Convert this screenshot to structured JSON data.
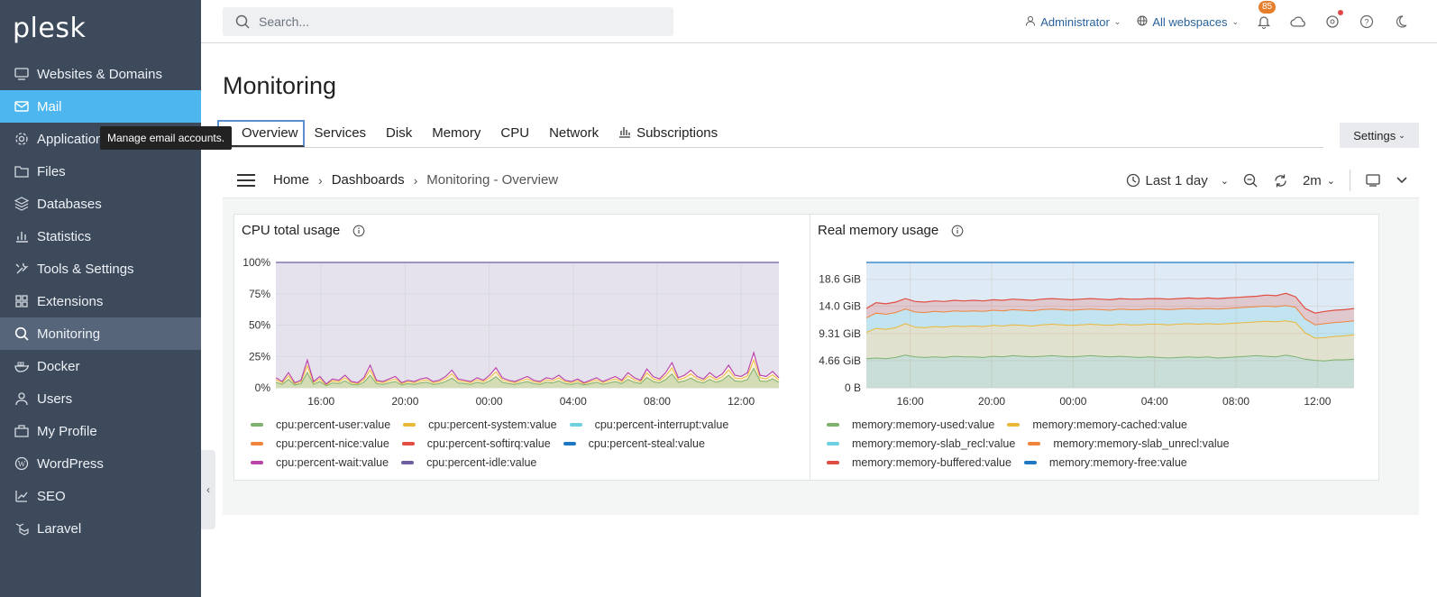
{
  "brand": "plesk",
  "sidebar": {
    "items": [
      {
        "label": "Websites & Domains",
        "icon": "monitor-icon"
      },
      {
        "label": "Mail",
        "icon": "mail-icon"
      },
      {
        "label": "Applications",
        "icon": "gear-icon"
      },
      {
        "label": "Files",
        "icon": "folder-icon"
      },
      {
        "label": "Databases",
        "icon": "database-icon"
      },
      {
        "label": "Statistics",
        "icon": "bar-chart-icon"
      },
      {
        "label": "Tools & Settings",
        "icon": "tools-icon"
      },
      {
        "label": "Extensions",
        "icon": "extensions-icon"
      },
      {
        "label": "Monitoring",
        "icon": "monitoring-icon"
      },
      {
        "label": "Docker",
        "icon": "docker-icon"
      },
      {
        "label": "Users",
        "icon": "user-icon"
      },
      {
        "label": "My Profile",
        "icon": "profile-icon"
      },
      {
        "label": "WordPress",
        "icon": "wordpress-icon"
      },
      {
        "label": "SEO",
        "icon": "seo-icon"
      },
      {
        "label": "Laravel",
        "icon": "laravel-icon"
      }
    ],
    "tooltip": "Manage email accounts.",
    "collapse_glyph": "‹"
  },
  "topbar": {
    "search_placeholder": "Search...",
    "user": "Administrator",
    "webspaces": "All webspaces",
    "notifications_count": "85"
  },
  "page": {
    "title": "Monitoring",
    "tabs": [
      "Overview",
      "Services",
      "Disk",
      "Memory",
      "CPU",
      "Network",
      "Subscriptions"
    ],
    "settings_label": "Settings"
  },
  "dashboard": {
    "breadcrumb": [
      "Home",
      "Dashboards",
      "Monitoring - Overview"
    ],
    "time_range": "Last 1 day",
    "refresh": "2m"
  },
  "colors": {
    "sidebar": "#3d4a5c",
    "active": "#4db6ef",
    "green": "#7eb26d",
    "yellow": "#eab839",
    "lightblue": "#6ed0e0",
    "orange": "#ef843c",
    "red": "#e24d42",
    "blue": "#1f78c1",
    "magenta": "#ba43a9",
    "purple": "#705da0"
  },
  "chart_data": [
    {
      "type": "area",
      "title": "CPU total usage",
      "x_ticks": [
        "16:00",
        "20:00",
        "00:00",
        "04:00",
        "08:00",
        "12:00"
      ],
      "y_ticks": [
        "0%",
        "25%",
        "50%",
        "75%",
        "100%"
      ],
      "ylim": [
        0,
        100
      ],
      "series": [
        {
          "name": "cpu:percent-user:value",
          "color": "#7eb26d"
        },
        {
          "name": "cpu:percent-system:value",
          "color": "#eab839"
        },
        {
          "name": "cpu:percent-interrupt:value",
          "color": "#6ed0e0"
        },
        {
          "name": "cpu:percent-nice:value",
          "color": "#ef843c"
        },
        {
          "name": "cpu:percent-softirq:value",
          "color": "#e24d42"
        },
        {
          "name": "cpu:percent-steal:value",
          "color": "#1f78c1"
        },
        {
          "name": "cpu:percent-wait:value",
          "color": "#ba43a9"
        },
        {
          "name": "cpu:percent-idle:value",
          "color": "#705da0"
        }
      ],
      "busy_total": [
        8,
        5,
        12,
        4,
        6,
        22,
        5,
        9,
        3,
        7,
        6,
        10,
        5,
        4,
        8,
        18,
        6,
        5,
        7,
        9,
        4,
        6,
        5,
        7,
        8,
        5,
        6,
        9,
        14,
        7,
        6,
        5,
        8,
        6,
        10,
        16,
        8,
        6,
        5,
        7,
        9,
        6,
        5,
        8,
        7,
        10,
        6,
        5,
        7,
        4,
        6,
        8,
        5,
        7,
        9,
        6,
        12,
        8,
        6,
        15,
        9,
        7,
        12,
        20,
        8,
        10,
        14,
        9,
        7,
        12,
        8,
        11,
        18,
        10,
        9,
        12,
        28,
        10,
        9,
        13,
        8
      ]
    },
    {
      "type": "area",
      "title": "Real memory usage",
      "x_ticks": [
        "16:00",
        "20:00",
        "00:00",
        "04:00",
        "08:00",
        "12:00"
      ],
      "y_ticks": [
        "0 B",
        "4.66 GiB",
        "9.31 GiB",
        "14.0 GiB",
        "18.6 GiB"
      ],
      "ylim_gib": [
        0,
        21.5
      ],
      "series": [
        {
          "name": "memory:memory-used:value",
          "color": "#7eb26d"
        },
        {
          "name": "memory:memory-cached:value",
          "color": "#eab839"
        },
        {
          "name": "memory:memory-slab_recl:value",
          "color": "#6ed0e0"
        },
        {
          "name": "memory:memory-slab_unrecl:value",
          "color": "#ef843c"
        },
        {
          "name": "memory:memory-buffered:value",
          "color": "#e24d42"
        },
        {
          "name": "memory:memory-free:value",
          "color": "#1f78c1"
        }
      ],
      "used_gib": [
        5.0,
        5.1,
        5.0,
        5.2,
        5.6,
        5.3,
        5.2,
        5.3,
        5.2,
        5.4,
        5.3,
        5.3,
        5.2,
        5.4,
        5.3,
        5.5,
        5.4,
        5.3,
        5.4,
        5.5,
        5.4,
        5.3,
        5.4,
        5.5,
        5.4,
        5.3,
        5.4,
        5.3,
        5.2,
        5.3,
        5.2,
        5.1,
        5.2,
        5.3,
        5.2,
        5.3,
        5.1,
        5.2,
        5.3,
        5.4,
        5.5,
        5.4,
        5.3,
        5.6,
        5.3,
        4.9,
        4.7,
        4.6,
        4.8,
        4.8,
        4.9
      ],
      "cached_gib": [
        9.5,
        10.2,
        10.0,
        10.3,
        11.0,
        10.4,
        10.3,
        10.5,
        10.4,
        10.6,
        10.5,
        10.6,
        10.5,
        10.7,
        10.6,
        10.8,
        10.7,
        10.6,
        10.8,
        10.9,
        10.8,
        10.7,
        10.8,
        10.9,
        10.8,
        10.7,
        10.9,
        10.8,
        10.8,
        10.9,
        10.9,
        10.8,
        10.9,
        11.0,
        10.9,
        11.0,
        10.9,
        11.0,
        11.1,
        11.2,
        11.3,
        11.4,
        11.3,
        11.5,
        11.2,
        9.4,
        8.5,
        8.6,
        8.8,
        8.9,
        9.1
      ],
      "slab_gib": [
        12.0,
        12.8,
        12.6,
        12.9,
        13.5,
        13.0,
        12.9,
        13.1,
        13.0,
        13.2,
        13.1,
        13.2,
        13.1,
        13.3,
        13.2,
        13.4,
        13.3,
        13.2,
        13.4,
        13.5,
        13.4,
        13.3,
        13.4,
        13.5,
        13.4,
        13.3,
        13.5,
        13.4,
        13.4,
        13.5,
        13.5,
        13.4,
        13.5,
        13.6,
        13.5,
        13.6,
        13.5,
        13.6,
        13.7,
        13.8,
        13.9,
        14.0,
        13.9,
        14.1,
        13.8,
        11.8,
        10.8,
        11.0,
        11.2,
        11.3,
        11.5
      ],
      "buffer_gib": [
        13.6,
        14.6,
        14.4,
        14.7,
        15.3,
        14.8,
        14.7,
        14.9,
        14.8,
        15.0,
        14.9,
        15.0,
        14.9,
        15.1,
        15.0,
        15.2,
        15.1,
        15.0,
        15.2,
        15.3,
        15.2,
        15.1,
        15.2,
        15.3,
        15.2,
        15.1,
        15.3,
        15.2,
        15.2,
        15.3,
        15.3,
        15.2,
        15.3,
        15.4,
        15.3,
        15.4,
        15.3,
        15.4,
        15.5,
        15.6,
        15.7,
        15.9,
        15.8,
        16.2,
        15.6,
        13.6,
        12.8,
        13.1,
        13.3,
        13.4,
        13.6
      ]
    }
  ]
}
